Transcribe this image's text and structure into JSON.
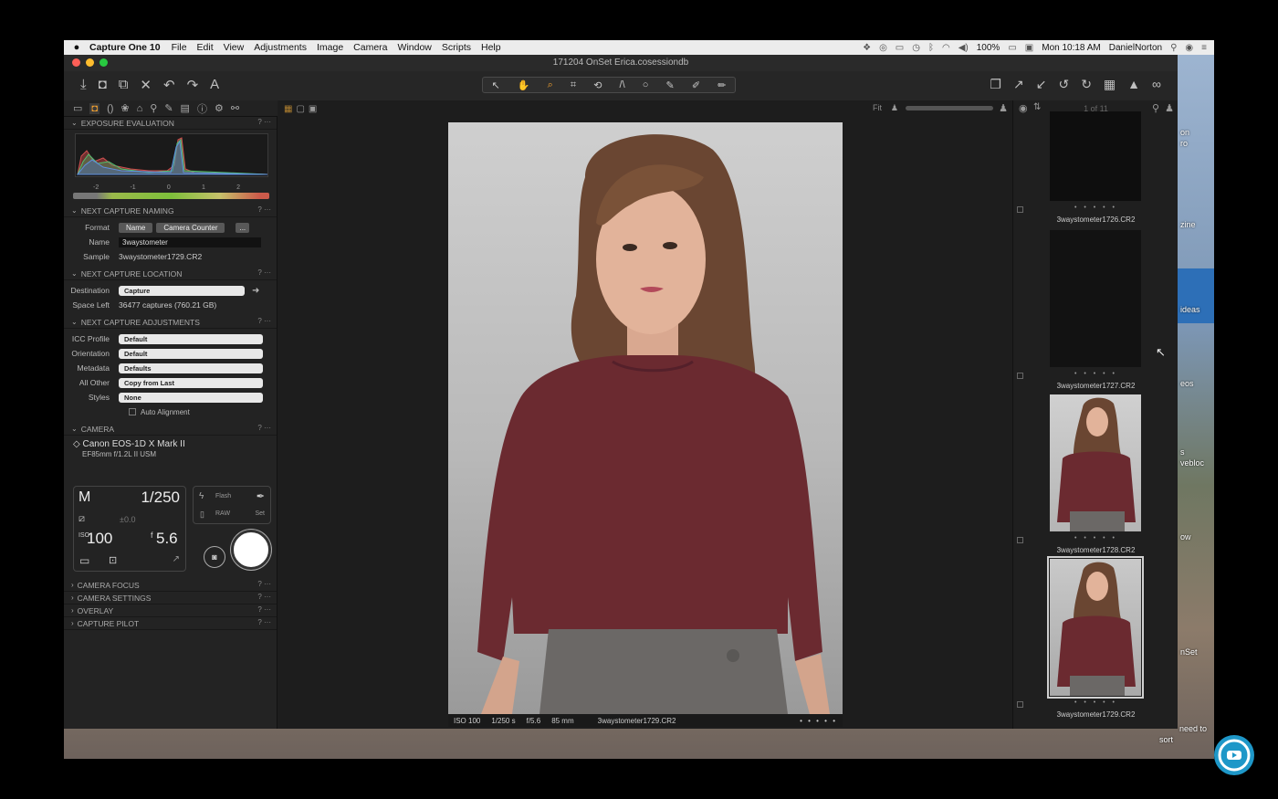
{
  "menubar": {
    "app_name": "Capture One 10",
    "menus": [
      "File",
      "Edit",
      "View",
      "Adjustments",
      "Image",
      "Camera",
      "Window",
      "Scripts",
      "Help"
    ],
    "battery": "100%",
    "clock": "Mon 10:18 AM",
    "user": "DanielNorton"
  },
  "window": {
    "title": "171204 OnSet Erica.cosessiondb"
  },
  "left_panel": {
    "exposure": {
      "title": "EXPOSURE EVALUATION",
      "scale": [
        "-2",
        "-1",
        "0",
        "1",
        "2"
      ]
    },
    "naming": {
      "title": "NEXT CAPTURE NAMING",
      "format_label": "Format",
      "format_tokens": [
        "Name",
        "Camera Counter"
      ],
      "more": "...",
      "name_label": "Name",
      "name_value": "3waystometer",
      "sample_label": "Sample",
      "sample_value": "3waystometer1729.CR2"
    },
    "location": {
      "title": "NEXT CAPTURE LOCATION",
      "destination_label": "Destination",
      "destination_value": "Capture",
      "space_label": "Space Left",
      "space_value": "36477 captures (760.21 GB)"
    },
    "adjustments": {
      "title": "NEXT CAPTURE ADJUSTMENTS",
      "rows": [
        {
          "label": "ICC Profile",
          "value": "Default"
        },
        {
          "label": "Orientation",
          "value": "Default"
        },
        {
          "label": "Metadata",
          "value": "Defaults"
        },
        {
          "label": "All Other",
          "value": "Copy from Last"
        },
        {
          "label": "Styles",
          "value": "None"
        }
      ],
      "auto_alignment": "Auto Alignment"
    },
    "camera": {
      "title": "CAMERA",
      "model": "Canon EOS-1D X Mark II",
      "lens": "EF85mm f/1.2L II USM",
      "mode": "M",
      "shutter": "1/250",
      "ev": "±0.0",
      "iso": "100",
      "aperture": "5.6",
      "flash": "Flash",
      "raw": "RAW",
      "set": "Set"
    },
    "collapsed": [
      "CAMERA FOCUS",
      "CAMERA SETTINGS",
      "OVERLAY",
      "CAPTURE PILOT"
    ]
  },
  "viewer": {
    "fit": "Fit",
    "info": {
      "iso": "ISO 100",
      "shutter": "1/250 s",
      "aperture": "f/5.6",
      "focal": "85 mm",
      "filename": "3waystometer1729.CR2"
    }
  },
  "browser": {
    "counter": "1 of 11",
    "dots": "• • • • •",
    "thumbnails": [
      {
        "name": "3waystometer1726.CR2"
      },
      {
        "name": "3waystometer1727.CR2"
      },
      {
        "name": "3waystometer1728.CR2"
      },
      {
        "name": "3waystometer1729.CR2"
      }
    ]
  },
  "desktop": {
    "labels": [
      "on",
      "ro",
      "zine",
      "ideas",
      "eos",
      "s",
      "vebloc",
      "ow",
      "nSet",
      "need to",
      "sort"
    ]
  },
  "colors": {
    "accent": "#f0a030",
    "panel": "#232323",
    "viewer": "#1d1d1d"
  },
  "icons": {
    "toolbar_left": [
      "import-icon",
      "capture-icon",
      "folder-export-icon",
      "delete-icon",
      "undo-icon",
      "redo-icon",
      "text-icon"
    ],
    "toolbar_right": [
      "stack-icon",
      "copy-adjust-icon",
      "apply-adjust-icon",
      "rotate-left-icon",
      "rotate-right-icon",
      "grid-icon",
      "warning-icon",
      "glasses-icon"
    ]
  }
}
